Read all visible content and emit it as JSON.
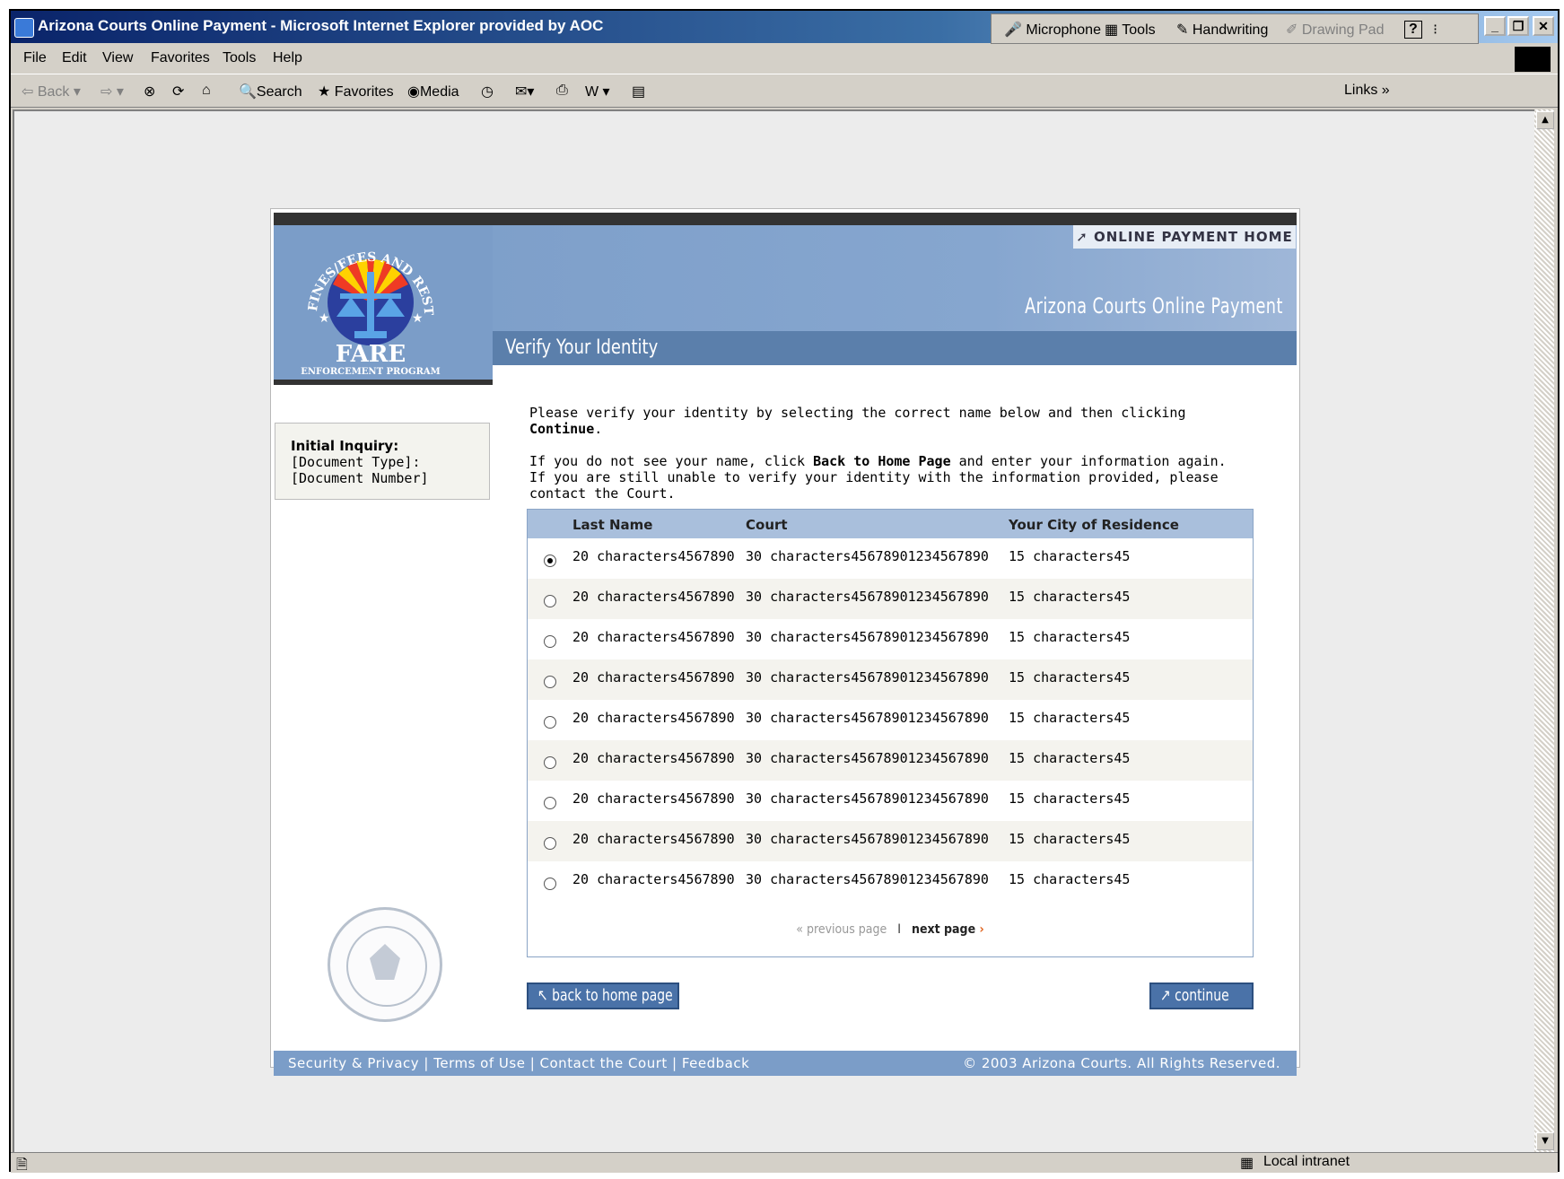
{
  "window": {
    "title": "Arizona Courts Online Payment - Microsoft Internet Explorer provided by AOC",
    "langbar": {
      "microphone": "Microphone",
      "tools": "Tools",
      "handwriting": "Handwriting",
      "drawing_pad": "Drawing Pad",
      "help": "?"
    },
    "controls": {
      "minimize": "_",
      "restore": "❐",
      "close": "✕"
    }
  },
  "menu": [
    "File",
    "Edit",
    "View",
    "Favorites",
    "Tools",
    "Help"
  ],
  "toolbar": {
    "back": "Back",
    "search": "Search",
    "favorites": "Favorites",
    "media": "Media",
    "links": "Links"
  },
  "status": {
    "zone": "Local intranet"
  },
  "page": {
    "home_link": "ONLINE PAYMENT HOME",
    "site_title": "Arizona Courts Online Payment",
    "section_title": "Verify Your Identity",
    "logo": {
      "name": "FARE",
      "subtitle": "ENFORCEMENT PROGRAM",
      "ring": "FINES/FEES AND RESTITUTION"
    },
    "inquiry": {
      "label": "Initial Inquiry:",
      "doc_type": "[Document Type]:",
      "doc_number": "[Document Number]"
    },
    "intro": {
      "line1_a": "Please verify your identity by selecting the correct name below and then clicking ",
      "line1_b": "Continue",
      "line1_c": ".",
      "line2_a": "If you do not see your name, click ",
      "line2_b": "Back to Home Page",
      "line2_c": " and enter your information again. If you are still unable to verify your identity with the information provided, please contact the Court."
    },
    "table": {
      "headers": {
        "last_name": "Last Name",
        "court": "Court",
        "city": "Your City of Residence"
      },
      "rows": [
        {
          "last_name": "20 characters4567890",
          "court": "30 characters45678901234567890",
          "city": "15 characters45",
          "selected": true
        },
        {
          "last_name": "20 characters4567890",
          "court": "30 characters45678901234567890",
          "city": "15 characters45",
          "selected": false
        },
        {
          "last_name": "20 characters4567890",
          "court": "30 characters45678901234567890",
          "city": "15 characters45",
          "selected": false
        },
        {
          "last_name": "20 characters4567890",
          "court": "30 characters45678901234567890",
          "city": "15 characters45",
          "selected": false
        },
        {
          "last_name": "20 characters4567890",
          "court": "30 characters45678901234567890",
          "city": "15 characters45",
          "selected": false
        },
        {
          "last_name": "20 characters4567890",
          "court": "30 characters45678901234567890",
          "city": "15 characters45",
          "selected": false
        },
        {
          "last_name": "20 characters4567890",
          "court": "30 characters45678901234567890",
          "city": "15 characters45",
          "selected": false
        },
        {
          "last_name": "20 characters4567890",
          "court": "30 characters45678901234567890",
          "city": "15 characters45",
          "selected": false
        },
        {
          "last_name": "20 characters4567890",
          "court": "30 characters45678901234567890",
          "city": "15 characters45",
          "selected": false
        }
      ],
      "pager": {
        "previous": "previous page",
        "separator": "I",
        "next": "next page"
      }
    },
    "buttons": {
      "back": "back to home page",
      "continue": "continue"
    },
    "footer": {
      "links": [
        "Security & Privacy",
        "Terms of Use",
        "Contact the Court",
        "Feedback"
      ],
      "copyright": "© 2003 Arizona Courts. All Rights Reserved."
    }
  }
}
